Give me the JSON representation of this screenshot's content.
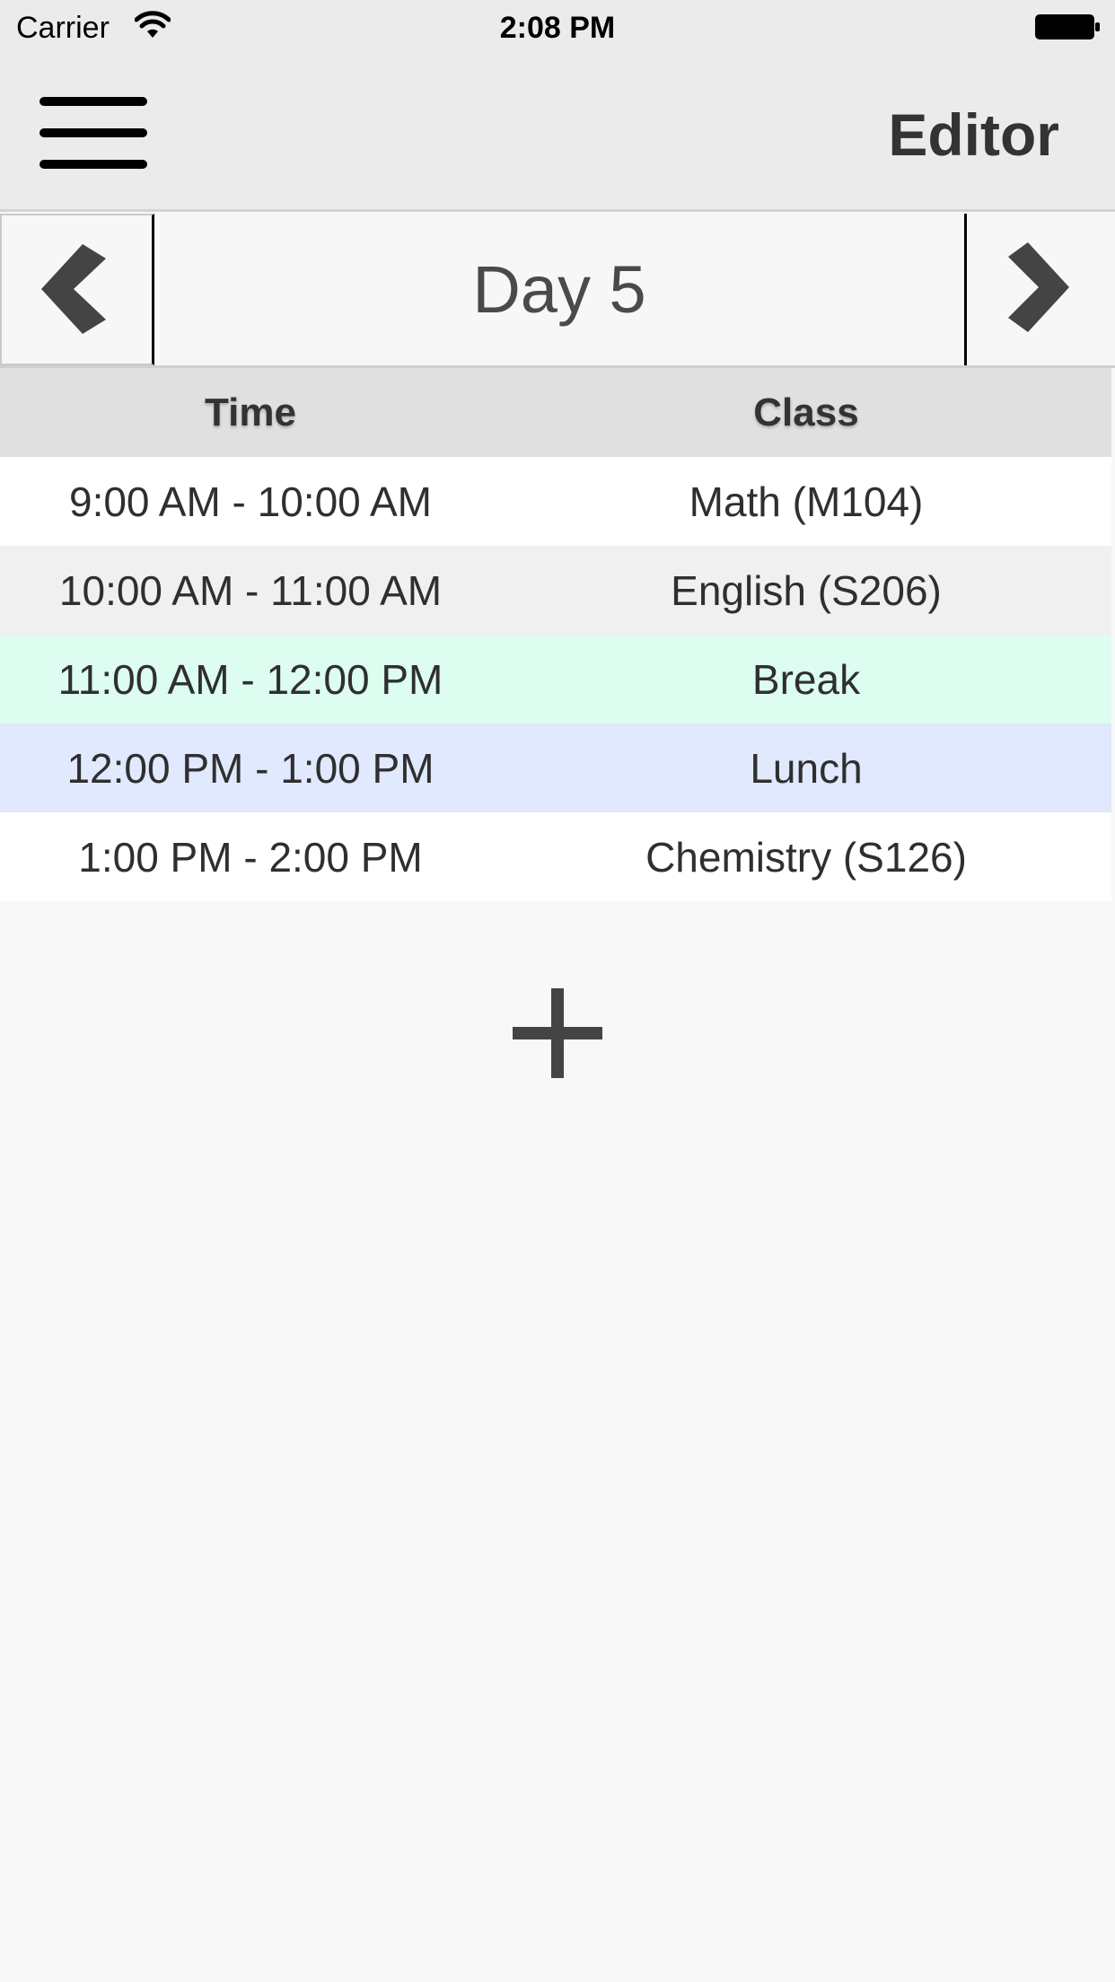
{
  "status_bar": {
    "carrier": "Carrier",
    "time": "2:08 PM",
    "wifi_icon": "wifi-icon",
    "battery_icon": "battery-full-icon"
  },
  "nav": {
    "title": "Editor",
    "menu_icon": "hamburger-menu-icon"
  },
  "day_selector": {
    "label": "Day 5",
    "prev_icon": "chevron-left-icon",
    "next_icon": "chevron-right-icon"
  },
  "table": {
    "headers": {
      "time": "Time",
      "class": "Class"
    },
    "rows": [
      {
        "time": "9:00 AM - 10:00 AM",
        "class": "Math (M104)",
        "color": "#ffffff"
      },
      {
        "time": "10:00 AM - 11:00 AM",
        "class": "English (S206)",
        "color": "#f0f0f0"
      },
      {
        "time": "11:00 AM - 12:00 PM",
        "class": "Break",
        "color": "#dcfdf0"
      },
      {
        "time": "12:00 PM - 1:00 PM",
        "class": "Lunch",
        "color": "#e0e9fd"
      },
      {
        "time": "1:00 PM - 2:00 PM",
        "class": "Chemistry (S126)",
        "color": "#ffffff"
      }
    ]
  },
  "add_button": {
    "icon": "plus-icon"
  },
  "colors": {
    "header_bg": "#e0e0e0",
    "bar_bg": "#ebebeb",
    "background": "#f8f8f8",
    "icon_dark": "#444444"
  }
}
